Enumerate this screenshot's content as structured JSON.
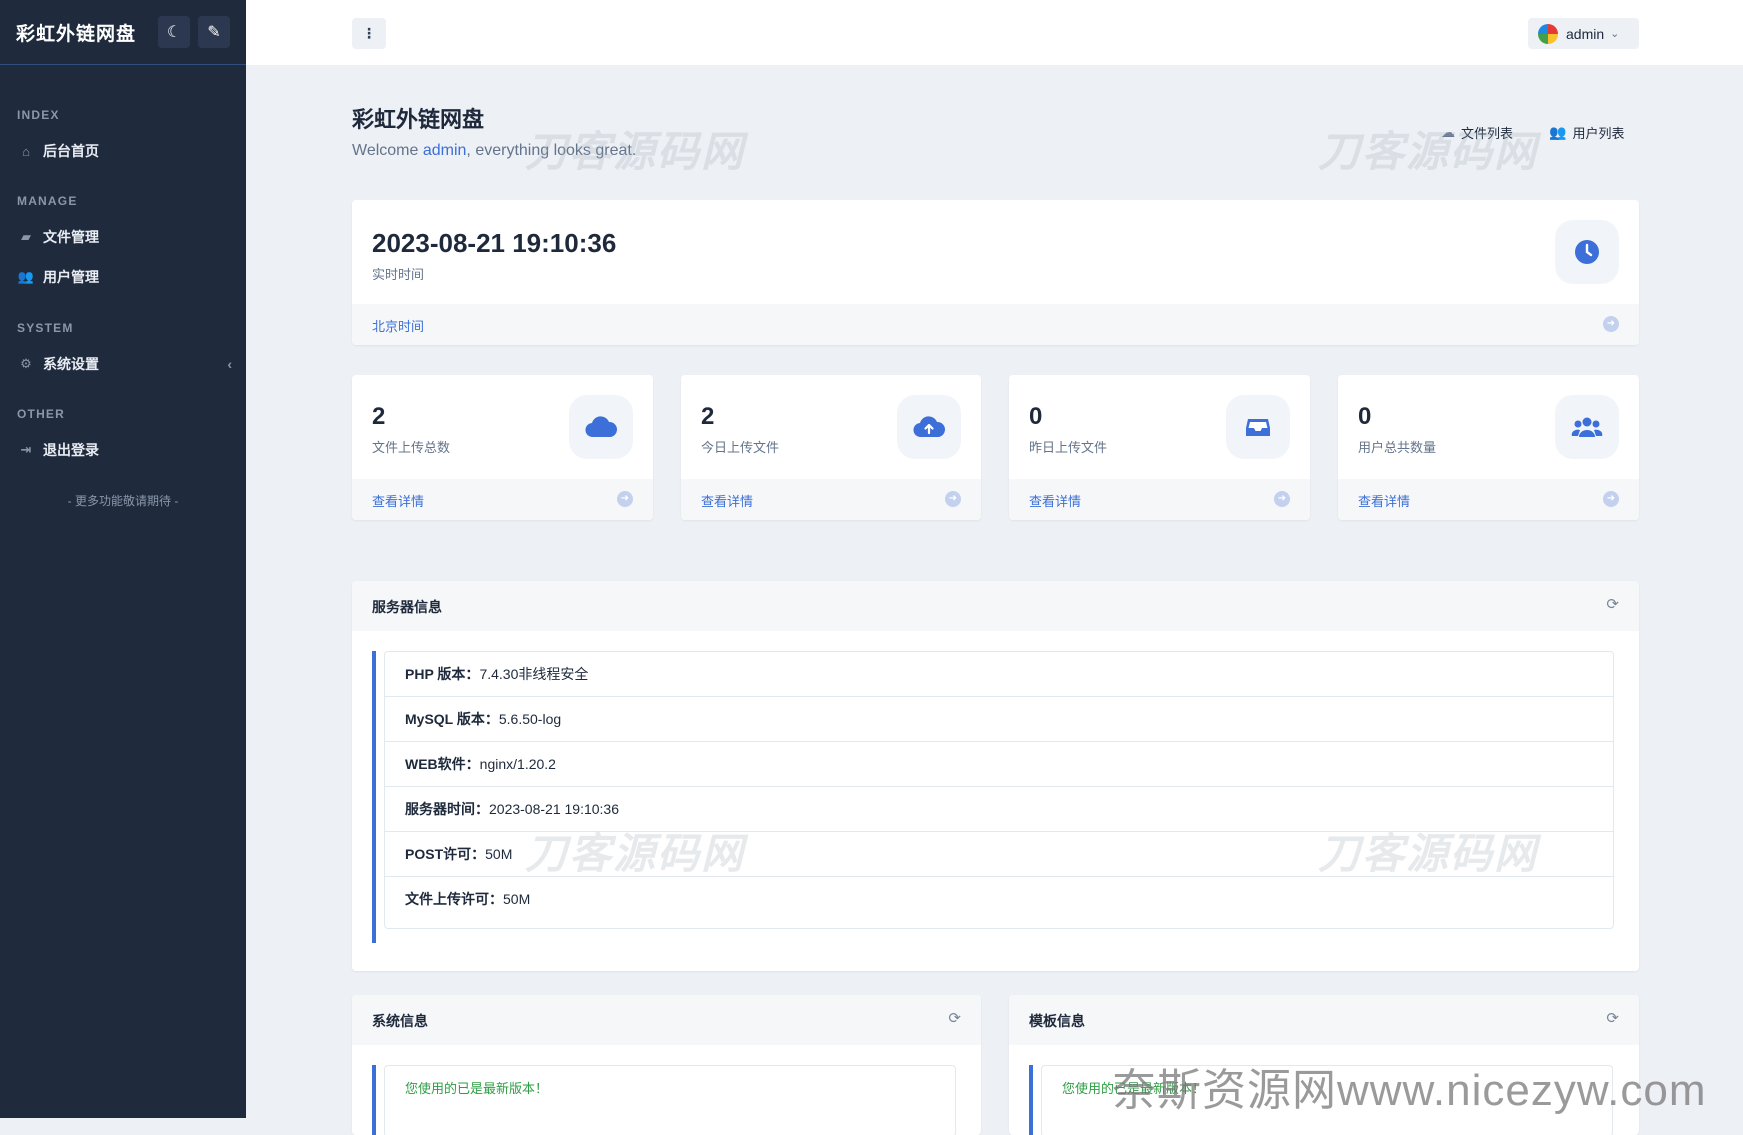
{
  "sidebar": {
    "brand": "彩虹外链网盘",
    "theme_icon": "moon-icon",
    "paint_icon": "brush-icon",
    "sections": [
      {
        "heading": "INDEX",
        "items": [
          {
            "label": "后台首页",
            "icon": "home-icon"
          }
        ]
      },
      {
        "heading": "MANAGE",
        "items": [
          {
            "label": "文件管理",
            "icon": "folder-icon"
          },
          {
            "label": "用户管理",
            "icon": "users-icon"
          }
        ]
      },
      {
        "heading": "SYSTEM",
        "items": [
          {
            "label": "系统设置",
            "icon": "gear-icon"
          }
        ]
      },
      {
        "heading": "OTHER",
        "items": [
          {
            "label": "退出登录",
            "icon": "logout-icon"
          }
        ]
      }
    ],
    "footer": "- 更多功能敬请期待 -"
  },
  "topbar": {
    "menu_label": "⋮",
    "user": "admin"
  },
  "header": {
    "title": "彩虹外链网盘",
    "welcome_prefix": "Welcome ",
    "welcome_user": "admin",
    "welcome_suffix": ", everything looks great.",
    "quick_links": [
      "文件列表",
      "用户列表"
    ]
  },
  "watermark": "刀客源码网",
  "time_card": {
    "value": "2023-08-21 19:10:36",
    "caption": "实时时间",
    "link": "北京时间"
  },
  "stats": [
    {
      "value": "2",
      "caption": "文件上传总数",
      "link": "查看详情",
      "icon": "cloud-icon"
    },
    {
      "value": "2",
      "caption": "今日上传文件",
      "link": "查看详情",
      "icon": "cloud-upload-icon"
    },
    {
      "value": "0",
      "caption": "昨日上传文件",
      "link": "查看详情",
      "icon": "inbox-icon"
    },
    {
      "value": "0",
      "caption": "用户总共数量",
      "link": "查看详情",
      "icon": "users-icon"
    }
  ],
  "server_info": {
    "title": "服务器信息",
    "rows": [
      {
        "label": "PHP 版本：",
        "value": "7.4.30非线程安全"
      },
      {
        "label": "MySQL 版本：",
        "value": "5.6.50-log"
      },
      {
        "label": "WEB软件：",
        "value": "nginx/1.20.2"
      },
      {
        "label": "服务器时间：",
        "value": "2023-08-21 19:10:36"
      },
      {
        "label": "POST许可：",
        "value": "50M"
      },
      {
        "label": "文件上传许可：",
        "value": "50M"
      }
    ]
  },
  "system_info": {
    "title": "系统信息",
    "message": "您使用的已是最新版本！"
  },
  "template_info": {
    "title": "模板信息",
    "message": "您使用的已是最新版本！"
  },
  "site_watermark": "奈斯资源网www.nicezyw.com"
}
